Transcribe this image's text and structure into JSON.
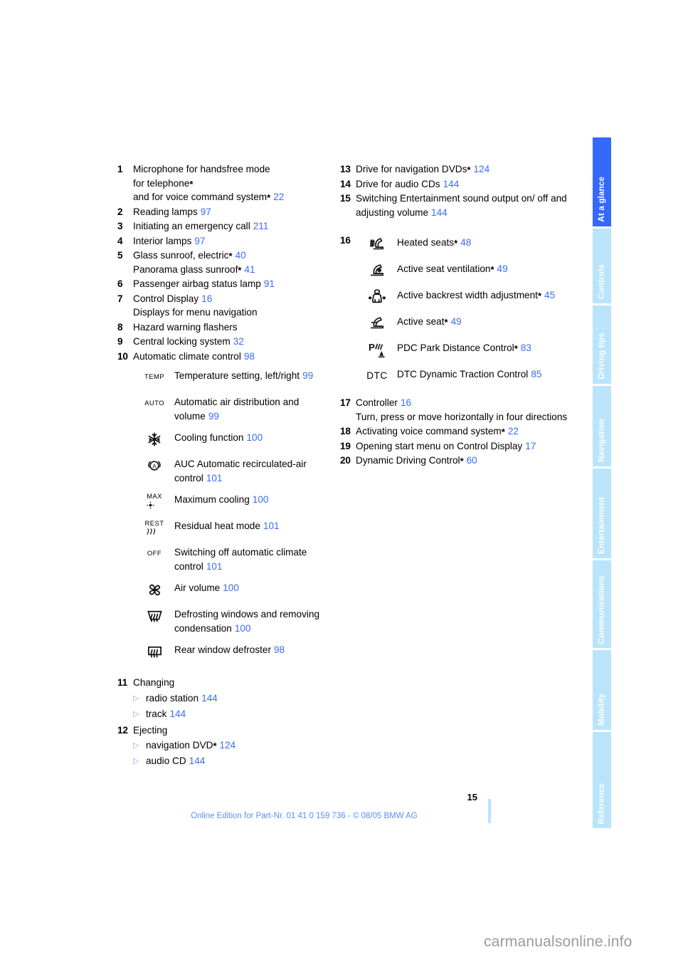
{
  "sidebar": {
    "tabs": [
      {
        "label": "At a glance",
        "active": true
      },
      {
        "label": "Controls",
        "active": false
      },
      {
        "label": "Driving tips",
        "active": false
      },
      {
        "label": "Navigation",
        "active": false
      },
      {
        "label": "Entertainment",
        "active": false
      },
      {
        "label": "Communications",
        "active": false
      },
      {
        "label": "Mobility",
        "active": false
      },
      {
        "label": "Reference",
        "active": false
      }
    ],
    "active_color": "#3569fd",
    "inactive_color": "#b9e4fc"
  },
  "left_column": {
    "items": [
      {
        "num": "1",
        "lines": [
          {
            "text": "Microphone for handsfree mode"
          },
          {
            "text": "for telephone",
            "star": true
          },
          {
            "text": "and for voice command system",
            "star": true,
            "page": "22"
          }
        ]
      },
      {
        "num": "2",
        "lines": [
          {
            "text": "Reading lamps",
            "page": "97"
          }
        ]
      },
      {
        "num": "3",
        "lines": [
          {
            "text": "Initiating an emergency call",
            "page": "211"
          }
        ]
      },
      {
        "num": "4",
        "lines": [
          {
            "text": "Interior lamps",
            "page": "97"
          }
        ]
      },
      {
        "num": "5",
        "lines": [
          {
            "text": "Glass sunroof, electric",
            "star": true,
            "page": "40"
          },
          {
            "text": "Panorama glass sunroof",
            "star": true,
            "page": "41"
          }
        ]
      },
      {
        "num": "6",
        "lines": [
          {
            "text": "Passenger airbag status lamp",
            "page": "91"
          }
        ]
      },
      {
        "num": "7",
        "lines": [
          {
            "text": "Control Display",
            "page": "16"
          },
          {
            "text": "Displays for menu navigation"
          }
        ]
      },
      {
        "num": "8",
        "lines": [
          {
            "text": "Hazard warning flashers"
          }
        ]
      },
      {
        "num": "9",
        "lines": [
          {
            "text": "Central locking system",
            "page": "32"
          }
        ]
      },
      {
        "num": "10",
        "lines": [
          {
            "text": "Automatic climate control",
            "page": "98"
          }
        ]
      }
    ],
    "climate_icons": [
      {
        "icon": "temp-icon",
        "glyph": "TEMP",
        "text": "Temperature setting, left/right",
        "page": "99"
      },
      {
        "icon": "auto-icon",
        "glyph": "AUTO",
        "text": "Automatic air distribution and volume",
        "page": "99"
      },
      {
        "icon": "snowflake-icon",
        "glyph": "",
        "text": "Cooling function",
        "page": "100"
      },
      {
        "icon": "auc-recirculation-icon",
        "glyph": "",
        "text": "AUC Automatic recirculated-air control",
        "page": "101"
      },
      {
        "icon": "max-cooling-icon",
        "glyph": "MAX",
        "text": "Maximum cooling",
        "page": "100"
      },
      {
        "icon": "residual-heat-icon",
        "glyph": "REST",
        "text": "Residual heat mode",
        "page": "101"
      },
      {
        "icon": "off-icon",
        "glyph": "OFF",
        "text": "Switching off automatic climate control",
        "page": "101"
      },
      {
        "icon": "fan-icon",
        "glyph": "",
        "text": "Air volume",
        "page": "100"
      },
      {
        "icon": "windshield-defrost-icon",
        "glyph": "",
        "text": "Defrosting windows and removing condensation",
        "page": "100"
      },
      {
        "icon": "rear-defroster-icon",
        "glyph": "",
        "text": "Rear window defroster",
        "page": "98"
      }
    ],
    "bullet_items": [
      {
        "num": "11",
        "title": "Changing",
        "bullets": [
          {
            "text": "radio station",
            "page": "144"
          },
          {
            "text": "track",
            "page": "144"
          }
        ]
      },
      {
        "num": "12",
        "title": "Ejecting",
        "bullets": [
          {
            "text": "navigation DVD",
            "star": true,
            "page": "124"
          },
          {
            "text": "audio CD",
            "page": "144"
          }
        ]
      }
    ]
  },
  "right_column": {
    "items_top": [
      {
        "num": "13",
        "lines": [
          {
            "text": "Drive for navigation DVDs",
            "star": true,
            "page": "124"
          }
        ]
      },
      {
        "num": "14",
        "lines": [
          {
            "text": "Drive for audio CDs",
            "page": "144"
          }
        ]
      },
      {
        "num": "15",
        "lines": [
          {
            "text": "Switching Entertainment sound output on/ off and adjusting volume",
            "page": "144"
          }
        ]
      }
    ],
    "group_16_num": "16",
    "seat_icons": [
      {
        "icon": "heated-seat-icon",
        "text": "Heated seats",
        "star": true,
        "page": "48"
      },
      {
        "icon": "seat-ventilation-icon",
        "text": "Active seat ventilation",
        "star": true,
        "page": "49"
      },
      {
        "icon": "backrest-width-icon",
        "text": "Active backrest width adjustment",
        "star": true,
        "page": "45"
      },
      {
        "icon": "active-seat-icon",
        "text": "Active seat",
        "star": true,
        "page": "49"
      },
      {
        "icon": "pdc-icon",
        "text": "PDC Park Distance Control",
        "star": true,
        "page": "83"
      },
      {
        "icon": "dtc-icon",
        "glyph": "DTC",
        "text": "DTC Dynamic Traction Control",
        "page": "85"
      }
    ],
    "items_bottom": [
      {
        "num": "17",
        "lines": [
          {
            "text": "Controller",
            "page": "16"
          },
          {
            "text": "Turn, press or move horizontally in four directions"
          }
        ]
      },
      {
        "num": "18",
        "lines": [
          {
            "text": "Activating voice command system",
            "star": true,
            "page": "22"
          }
        ]
      },
      {
        "num": "19",
        "lines": [
          {
            "text": "Opening start menu on Control Display",
            "page": "17"
          }
        ]
      },
      {
        "num": "20",
        "lines": [
          {
            "text": "Dynamic Driving Control",
            "star": true,
            "page": "60"
          }
        ]
      }
    ]
  },
  "footer": {
    "page_number": "15",
    "note": "Online Edition for Part-Nr. 01 41 0 159 736 - © 08/05 BMW AG",
    "watermark": "carmanualsonline.info"
  }
}
